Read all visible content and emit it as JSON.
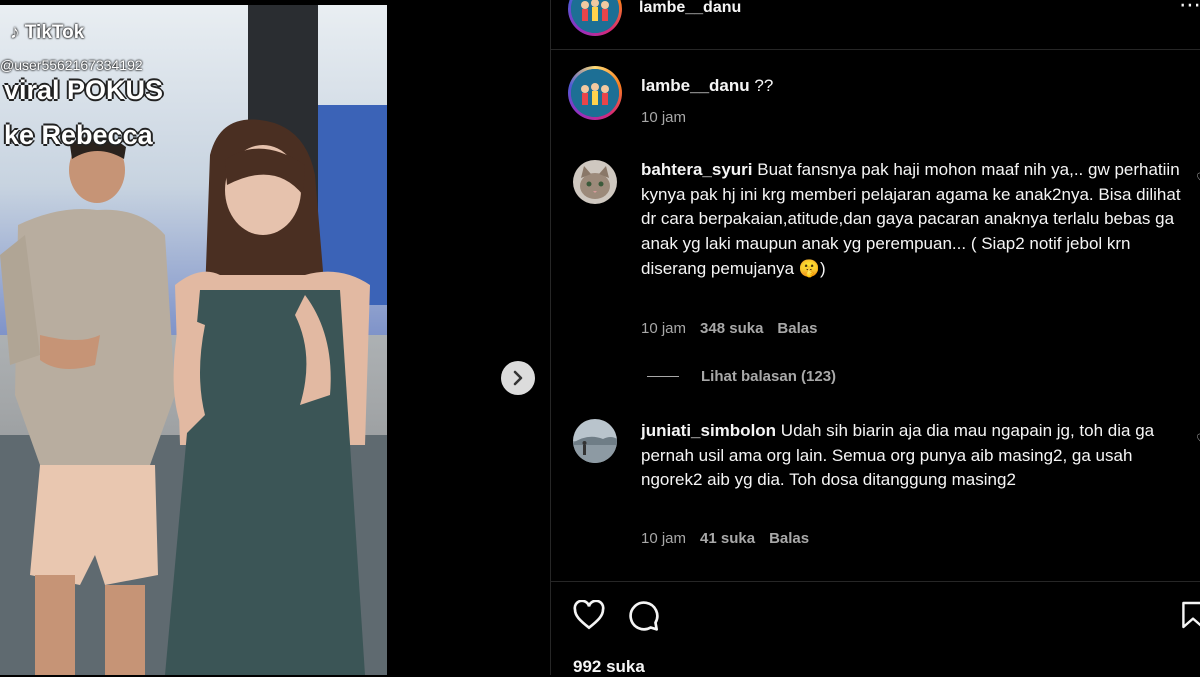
{
  "media": {
    "platform_label": "TikTok",
    "username": "@user5562167334192",
    "caption_line1": "viral POKUS",
    "caption_line2": "ke Rebecca"
  },
  "navigation": {
    "next_icon": "chevron-right-icon"
  },
  "post": {
    "author": "lambe__danu",
    "caption_author": "lambe__danu",
    "caption_text": "??",
    "caption_time": "10 jam",
    "likes": "992 suka"
  },
  "comments": [
    {
      "username": "bahtera_syuri",
      "text": "Buat fansnya pak haji mohon maaf nih ya,.. gw perhatiin kynya pak hj ini krg memberi pelajaran agama ke anak2nya. Bisa dilihat dr cara berpakaian,atitude,dan gaya pacaran anaknya terlalu bebas ga anak yg laki maupun anak yg perempuan... ( Siap2 notif jebol krn diserang pemujanya 🤫)",
      "time": "10 jam",
      "likes": "348 suka",
      "reply": "Balas",
      "view_replies": "Lihat balasan (123)"
    },
    {
      "username": "juniati_simbolon",
      "text": "Udah sih biarin aja dia mau ngapain jg, toh dia ga pernah usil ama org lain. Semua org punya aib masing2, ga usah ngorek2 aib yg dia. Toh dosa ditanggung masing2",
      "time": "10 jam",
      "likes": "41 suka",
      "reply": "Balas"
    }
  ],
  "colors": {
    "background": "#000000",
    "text": "#f5f5f5",
    "secondary": "#a8a8a8",
    "divider": "#262626"
  }
}
